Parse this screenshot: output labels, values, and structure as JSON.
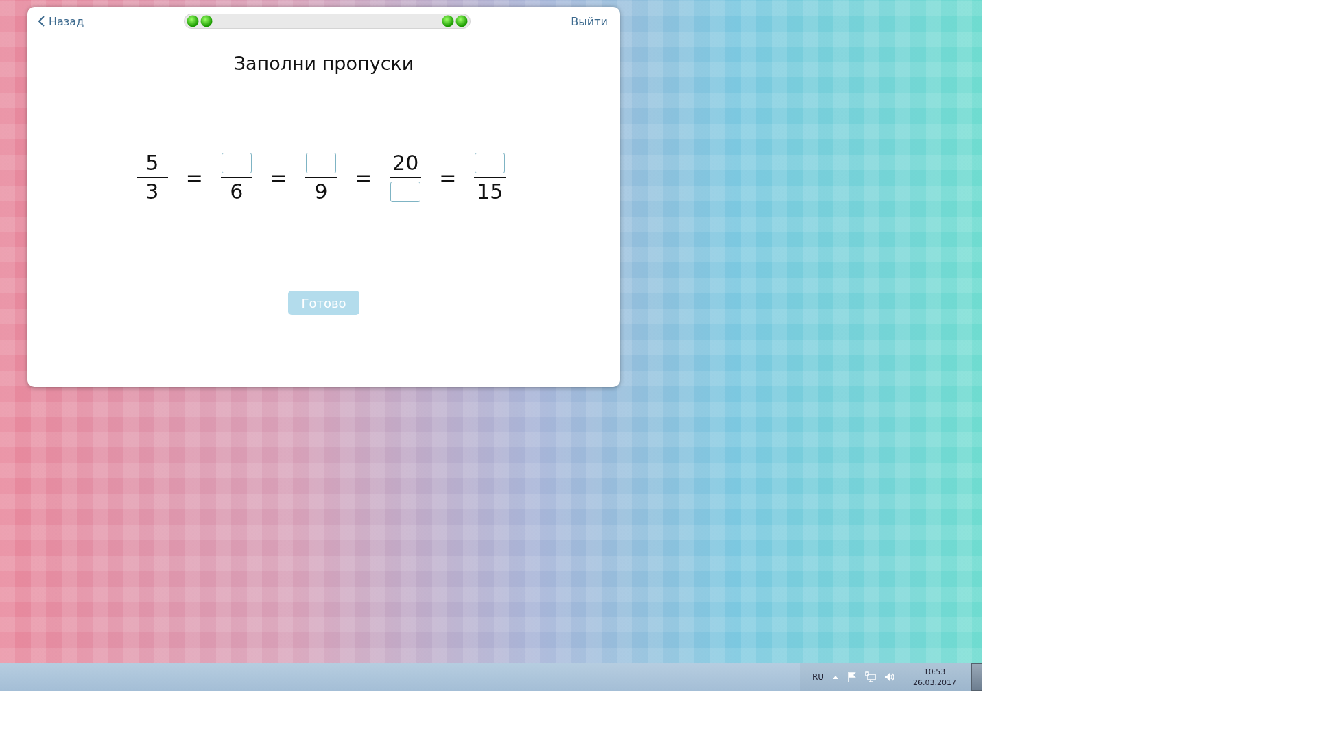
{
  "window": {
    "back": "Назад",
    "exit": "Выйти"
  },
  "progress": {
    "left_dots": [
      {
        "on": true
      },
      {
        "on": true
      }
    ],
    "right_dots": [
      {
        "on": true
      },
      {
        "on": true
      }
    ]
  },
  "title": "Заполни пропуски",
  "equation": [
    {
      "kind": "fraction",
      "numerator": {
        "kind": "value",
        "text": "5"
      },
      "denominator": {
        "kind": "value",
        "text": "3"
      }
    },
    {
      "kind": "sign",
      "text": "="
    },
    {
      "kind": "fraction",
      "numerator": {
        "kind": "blank"
      },
      "denominator": {
        "kind": "value",
        "text": "6"
      }
    },
    {
      "kind": "sign",
      "text": "="
    },
    {
      "kind": "fraction",
      "numerator": {
        "kind": "blank"
      },
      "denominator": {
        "kind": "value",
        "text": "9"
      }
    },
    {
      "kind": "sign",
      "text": "="
    },
    {
      "kind": "fraction",
      "numerator": {
        "kind": "value",
        "text": "20"
      },
      "denominator": {
        "kind": "blank"
      }
    },
    {
      "kind": "sign",
      "text": "="
    },
    {
      "kind": "fraction",
      "numerator": {
        "kind": "blank"
      },
      "denominator": {
        "kind": "value",
        "text": "15"
      }
    }
  ],
  "done_button": {
    "label": "Готово",
    "disabled": true
  },
  "taskbar": {
    "language": "RU",
    "time": "10:53",
    "date": "26.03.2017"
  }
}
